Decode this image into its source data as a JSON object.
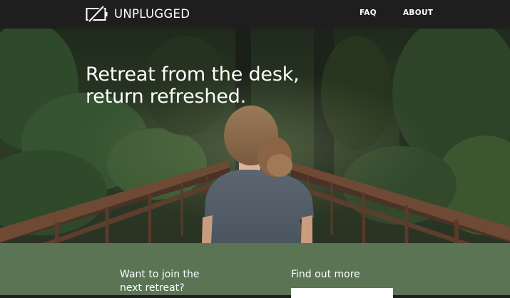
{
  "nav": {
    "logo_text": "UNPLUGGED",
    "links": [
      "FAQ",
      "ABOUT"
    ]
  },
  "hero": {
    "title_lines": [
      "Retreat from the desk,",
      "return refreshed."
    ]
  },
  "signup": {
    "join_heading_lines": [
      "Want to join the",
      "next retreat?"
    ],
    "find_out_heading": "Find out more",
    "input_placeholder": ""
  },
  "colors": {
    "nav_background": "#1e1e1e",
    "section_background": "#5a7454",
    "text": "#ffffff"
  },
  "icons": {
    "logo": "unplugged-battery-icon"
  }
}
